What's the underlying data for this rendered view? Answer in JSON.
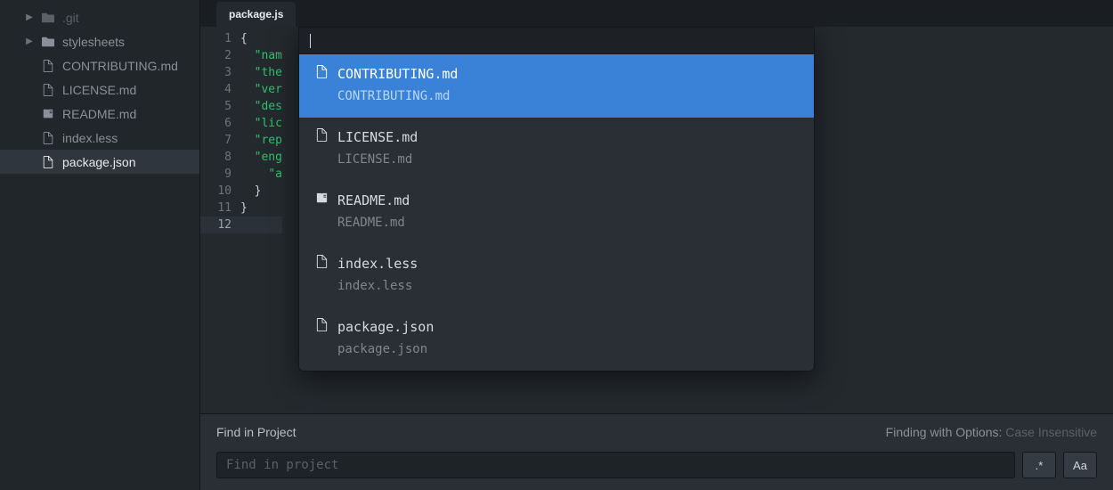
{
  "tree": {
    "items": [
      {
        "kind": "folder",
        "label": ".git",
        "depth": 1,
        "expandable": true,
        "dim": true
      },
      {
        "kind": "folder",
        "label": "stylesheets",
        "depth": 1,
        "expandable": true,
        "dim": false
      },
      {
        "kind": "file",
        "label": "CONTRIBUTING.md",
        "depth": 2,
        "icon": "file"
      },
      {
        "kind": "file",
        "label": "LICENSE.md",
        "depth": 2,
        "icon": "file"
      },
      {
        "kind": "file",
        "label": "README.md",
        "depth": 2,
        "icon": "book"
      },
      {
        "kind": "file",
        "label": "index.less",
        "depth": 2,
        "icon": "file"
      },
      {
        "kind": "file",
        "label": "package.json",
        "depth": 2,
        "icon": "file",
        "selected": true
      }
    ]
  },
  "tab": {
    "label": "package.js"
  },
  "editor": {
    "current_line": 12,
    "lines": [
      {
        "n": 1,
        "pre": "",
        "key": "",
        "brace": "{"
      },
      {
        "n": 2,
        "pre": "  ",
        "key": "\"nam",
        "brace": ""
      },
      {
        "n": 3,
        "pre": "  ",
        "key": "\"the",
        "brace": ""
      },
      {
        "n": 4,
        "pre": "  ",
        "key": "\"ver",
        "brace": ""
      },
      {
        "n": 5,
        "pre": "  ",
        "key": "\"des",
        "brace": ""
      },
      {
        "n": 6,
        "pre": "  ",
        "key": "\"lic",
        "brace": ""
      },
      {
        "n": 7,
        "pre": "  ",
        "key": "\"rep",
        "brace": ""
      },
      {
        "n": 8,
        "pre": "  ",
        "key": "\"eng",
        "brace": ""
      },
      {
        "n": 9,
        "pre": "    ",
        "key": "\"a",
        "brace": ""
      },
      {
        "n": 10,
        "pre": "  ",
        "key": "",
        "brace": "}"
      },
      {
        "n": 11,
        "pre": "",
        "key": "",
        "brace": "}"
      },
      {
        "n": 12,
        "pre": "",
        "key": "",
        "brace": ""
      }
    ]
  },
  "palette": {
    "query": "",
    "items": [
      {
        "name": "CONTRIBUTING.md",
        "path": "CONTRIBUTING.md",
        "icon": "file",
        "selected": true
      },
      {
        "name": "LICENSE.md",
        "path": "LICENSE.md",
        "icon": "file",
        "selected": false
      },
      {
        "name": "README.md",
        "path": "README.md",
        "icon": "book",
        "selected": false
      },
      {
        "name": "index.less",
        "path": "index.less",
        "icon": "file",
        "selected": false
      },
      {
        "name": "package.json",
        "path": "package.json",
        "icon": "file",
        "selected": false
      }
    ]
  },
  "find": {
    "title": "Find in Project",
    "status_label": "Finding with Options:",
    "status_value": "Case Insensitive",
    "placeholder": "Find in project",
    "regex_label": ".*",
    "case_label": "Aa"
  }
}
